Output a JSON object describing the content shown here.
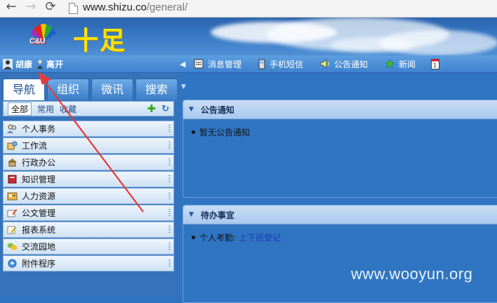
{
  "browser": {
    "url_host": "www.shizu.co",
    "url_path": "/general/",
    "back_icon": "arrow-left",
    "forward_icon": "arrow-right",
    "reload_icon": "reload"
  },
  "banner": {
    "logo_text": "C&U",
    "brand_title": "十足"
  },
  "toolbar": {
    "user_name": "胡康",
    "logout_label": "离开",
    "items": [
      {
        "label": "消息管理",
        "icon": "message-icon"
      },
      {
        "label": "手机短信",
        "icon": "mobile-phone-icon"
      },
      {
        "label": "公告通知",
        "icon": "speaker-icon"
      },
      {
        "label": "新闻",
        "icon": "star-icon"
      }
    ]
  },
  "leftnav": {
    "tabs": [
      "导航",
      "组织",
      "微讯",
      "搜索"
    ],
    "active_tab": "导航",
    "subtabs": [
      "全部",
      "常用",
      "收藏"
    ],
    "active_subtab": "全部",
    "menu": [
      {
        "label": "个人事务",
        "icon": "people-icon"
      },
      {
        "label": "工作流",
        "icon": "workflow-icon"
      },
      {
        "label": "行政办公",
        "icon": "office-icon"
      },
      {
        "label": "知识管理",
        "icon": "book-icon"
      },
      {
        "label": "人力资源",
        "icon": "hr-icon"
      },
      {
        "label": "公文管理",
        "icon": "document-pen-icon"
      },
      {
        "label": "报表系统",
        "icon": "report-pencil-icon"
      },
      {
        "label": "交流园地",
        "icon": "chat-icon"
      },
      {
        "label": "附件程序",
        "icon": "attachment-icon"
      }
    ]
  },
  "main": {
    "announcements": {
      "title": "公告通知",
      "items": [
        "暂无公告通知"
      ]
    },
    "todo": {
      "title": "待办事宜",
      "item_prefix": "个人考勤:",
      "item_link": "上下班登记"
    }
  },
  "watermark": "www.wooyun.org",
  "colors": {
    "page_bg": "#2f75c2",
    "brand_yellow": "#ffe400",
    "annotation_arrow": "#e53b3b"
  }
}
